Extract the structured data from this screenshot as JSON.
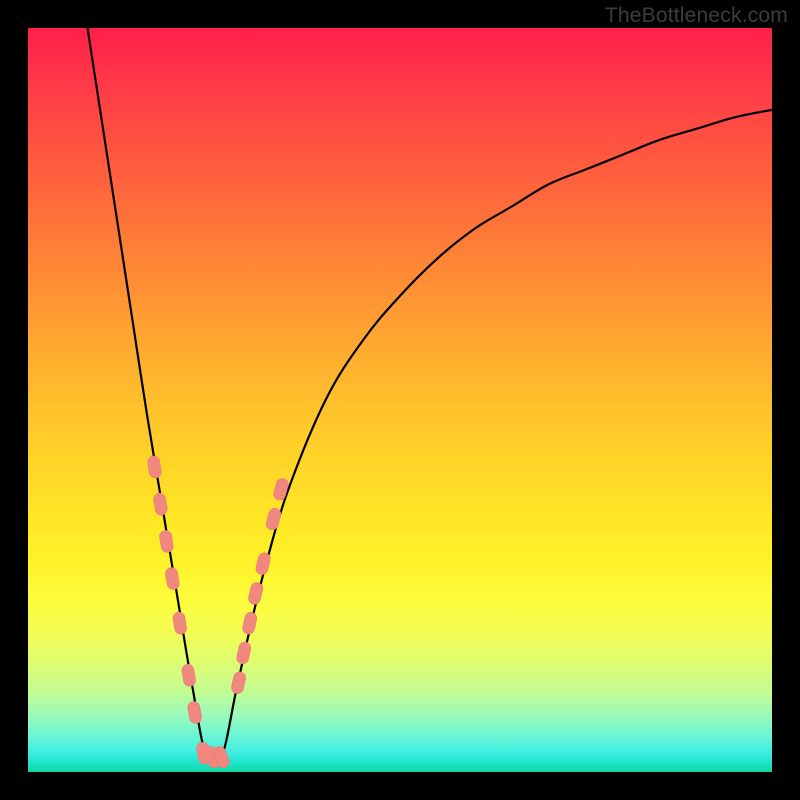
{
  "watermark": "TheBottleneck.com",
  "colors": {
    "frame": "#000000",
    "curve": "#000000",
    "marker_fill": "#f0887f",
    "marker_stroke": "#e97b72",
    "gradient_top": "#ff1f4a",
    "gradient_bottom": "#0fd69a"
  },
  "chart_data": {
    "type": "line",
    "title": "",
    "xlabel": "",
    "ylabel": "",
    "xlim": [
      0,
      100
    ],
    "ylim": [
      0,
      100
    ],
    "grid": false,
    "annotations": [
      "TheBottleneck.com"
    ],
    "note": "Axes are unlabeled in the image; x/y are normalized 0–100. y≈0 is ideal (green), y≈100 is worst (red). Curve minimum sits near x≈24.",
    "series": [
      {
        "name": "bottleneck-curve",
        "x": [
          8,
          10,
          12,
          14,
          16,
          18,
          20,
          22,
          24,
          26,
          28,
          30,
          32,
          35,
          40,
          45,
          50,
          55,
          60,
          65,
          70,
          75,
          80,
          85,
          90,
          95,
          100
        ],
        "values": [
          100,
          87,
          74,
          61,
          48,
          36,
          24,
          12,
          2,
          2,
          11,
          20,
          28,
          38,
          50,
          58,
          64,
          69,
          73,
          76,
          79,
          81,
          83,
          85,
          86.5,
          88,
          89
        ]
      }
    ],
    "markers": {
      "note": "Salmon pill-shaped markers clustered near the valley of the curve.",
      "points": [
        {
          "x": 17.0,
          "y": 41
        },
        {
          "x": 17.8,
          "y": 36
        },
        {
          "x": 18.6,
          "y": 31
        },
        {
          "x": 19.4,
          "y": 26
        },
        {
          "x": 20.4,
          "y": 20
        },
        {
          "x": 21.6,
          "y": 13
        },
        {
          "x": 22.4,
          "y": 8
        },
        {
          "x": 23.6,
          "y": 2.5
        },
        {
          "x": 24.8,
          "y": 2
        },
        {
          "x": 26.0,
          "y": 2
        },
        {
          "x": 28.3,
          "y": 12
        },
        {
          "x": 29.0,
          "y": 16
        },
        {
          "x": 29.8,
          "y": 20
        },
        {
          "x": 30.6,
          "y": 24
        },
        {
          "x": 31.6,
          "y": 28
        },
        {
          "x": 33.0,
          "y": 34
        },
        {
          "x": 34.0,
          "y": 38
        }
      ]
    }
  }
}
